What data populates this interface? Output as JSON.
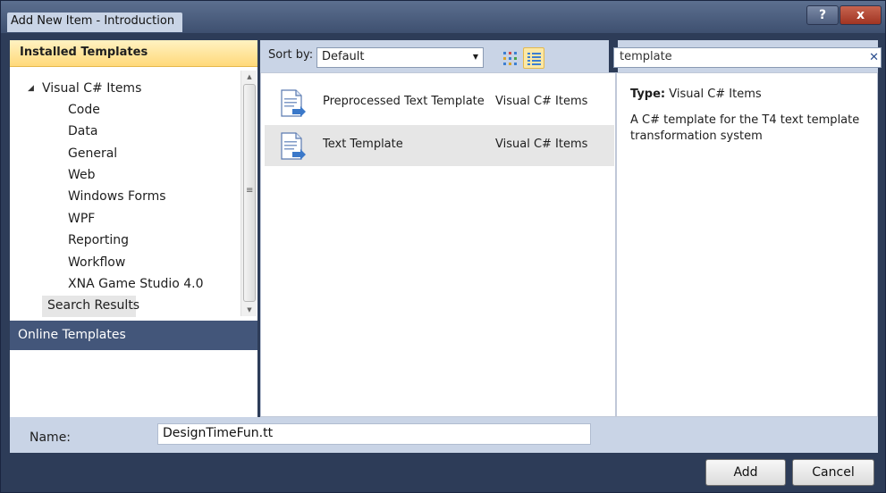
{
  "window": {
    "title": "Add New Item - Introduction",
    "help_label": "?",
    "close_label": "x"
  },
  "left_panel": {
    "installed_header": "Installed Templates",
    "tree_root": "Visual C# Items",
    "children": [
      "Code",
      "Data",
      "General",
      "Web",
      "Windows Forms",
      "WPF",
      "Reporting",
      "Workflow",
      "XNA Game Studio 4.0"
    ],
    "search_results": "Search Results",
    "online_header": "Online Templates"
  },
  "toolbar": {
    "sort_label": "Sort by:",
    "sort_value": "Default"
  },
  "search": {
    "value": "template",
    "clear_label": "✕"
  },
  "templates": [
    {
      "name": "Preprocessed Text Template",
      "type": "Visual C# Items",
      "selected": false
    },
    {
      "name": "Text Template",
      "type": "Visual C# Items",
      "selected": true
    }
  ],
  "details": {
    "type_label": "Type:",
    "type_value": "Visual C# Items",
    "description": "A C# template for the T4 text template transformation system"
  },
  "name_row": {
    "label": "Name:",
    "value": "DesignTimeFun.tt"
  },
  "buttons": {
    "add": "Add",
    "cancel": "Cancel"
  },
  "colors": {
    "frame": "#2d3c58",
    "header_gold": "#ffd97a",
    "online_header": "#43567a",
    "toolbar": "#c9d4e6"
  }
}
